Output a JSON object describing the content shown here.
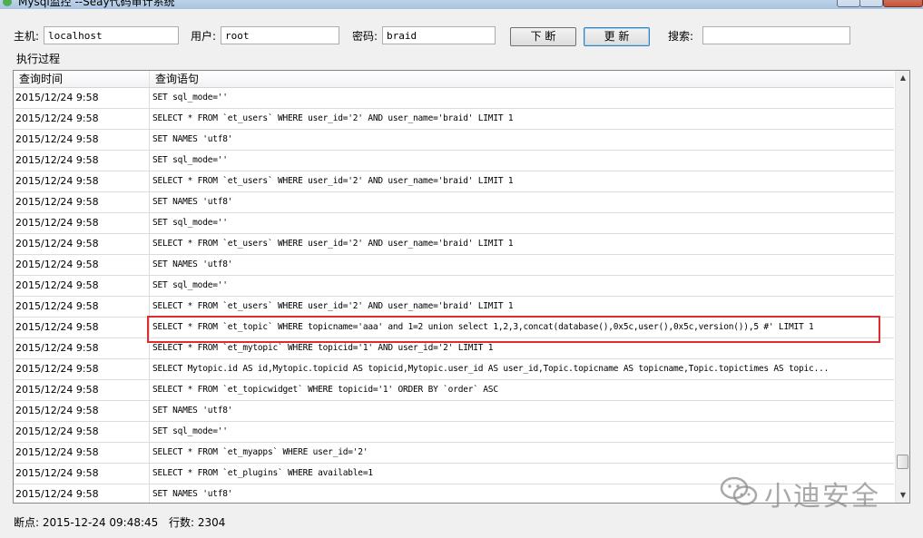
{
  "window": {
    "title": "Mysql监控 --Seay代码审计系统"
  },
  "form": {
    "host_label": "主机:",
    "host_value": "localhost",
    "user_label": "用户:",
    "user_value": "root",
    "password_label": "密码:",
    "password_value": "braid",
    "break_button": "下 断",
    "update_button": "更 新",
    "search_label": "搜索:",
    "search_value": ""
  },
  "log": {
    "group_label": "执行过程",
    "columns": [
      "查询时间",
      "查询语句"
    ],
    "rows": [
      {
        "time": "2015/12/24 9:58",
        "sql": "SET sql_mode=''"
      },
      {
        "time": "2015/12/24 9:58",
        "sql": "SELECT * FROM `et_users` WHERE user_id='2' AND user_name='braid' LIMIT 1"
      },
      {
        "time": "2015/12/24 9:58",
        "sql": "SET NAMES 'utf8'"
      },
      {
        "time": "2015/12/24 9:58",
        "sql": "SET sql_mode=''"
      },
      {
        "time": "2015/12/24 9:58",
        "sql": "SELECT * FROM `et_users` WHERE user_id='2' AND user_name='braid' LIMIT 1"
      },
      {
        "time": "2015/12/24 9:58",
        "sql": "SET NAMES 'utf8'"
      },
      {
        "time": "2015/12/24 9:58",
        "sql": "SET sql_mode=''"
      },
      {
        "time": "2015/12/24 9:58",
        "sql": "SELECT * FROM `et_users` WHERE user_id='2' AND user_name='braid' LIMIT 1"
      },
      {
        "time": "2015/12/24 9:58",
        "sql": "SET NAMES 'utf8'"
      },
      {
        "time": "2015/12/24 9:58",
        "sql": "SET sql_mode=''"
      },
      {
        "time": "2015/12/24 9:58",
        "sql": "SELECT * FROM `et_users` WHERE user_id='2' AND user_name='braid' LIMIT 1"
      },
      {
        "time": "2015/12/24 9:58",
        "sql": "SELECT * FROM `et_topic` WHERE topicname='aaa' and 1=2 union select 1,2,3,concat(database(),0x5c,user(),0x5c,version()),5 #' LIMIT 1"
      },
      {
        "time": "2015/12/24 9:58",
        "sql": "SELECT * FROM `et_mytopic` WHERE topicid='1' AND user_id='2' LIMIT 1"
      },
      {
        "time": "2015/12/24 9:58",
        "sql": "SELECT Mytopic.id AS id,Mytopic.topicid AS topicid,Mytopic.user_id AS user_id,Topic.topicname AS topicname,Topic.topictimes AS topic..."
      },
      {
        "time": "2015/12/24 9:58",
        "sql": "SELECT * FROM `et_topicwidget` WHERE topicid='1' ORDER BY `order` ASC"
      },
      {
        "time": "2015/12/24 9:58",
        "sql": "SET NAMES 'utf8'"
      },
      {
        "time": "2015/12/24 9:58",
        "sql": "SET sql_mode=''"
      },
      {
        "time": "2015/12/24 9:58",
        "sql": "SELECT * FROM `et_myapps` WHERE user_id='2'"
      },
      {
        "time": "2015/12/24 9:58",
        "sql": "SELECT * FROM `et_plugins` WHERE available=1"
      },
      {
        "time": "2015/12/24 9:58",
        "sql": "SET NAMES 'utf8'"
      }
    ],
    "highlighted_row_index": 11
  },
  "watermark": {
    "text": "小迪安全",
    "icon": "wechat-icon"
  },
  "status": {
    "breakpoint": "断点: 2015-12-24 09:48:45",
    "rowcount": "行数: 2304"
  },
  "colors": {
    "highlight": "#e02c2c"
  }
}
